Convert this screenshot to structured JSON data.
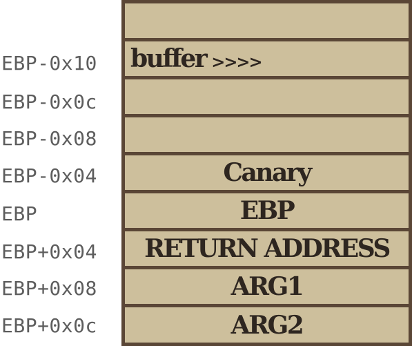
{
  "diagram": {
    "rows": [
      {
        "address": "",
        "content": ""
      },
      {
        "address": "EBP-0x10",
        "content": "buffer",
        "suffix": ">>>>"
      },
      {
        "address": "EBP-0x0c",
        "content": ""
      },
      {
        "address": "EBP-0x08",
        "content": ""
      },
      {
        "address": "EBP-0x04",
        "content": "Canary"
      },
      {
        "address": "EBP",
        "content": "EBP"
      },
      {
        "address": "EBP+0x04",
        "content": "RETURN ADDRESS"
      },
      {
        "address": "EBP+0x08",
        "content": "ARG1"
      },
      {
        "address": "EBP+0x0c",
        "content": "ARG2"
      }
    ]
  },
  "colors": {
    "cell_fill": "#cdbf9c",
    "border": "#5a4636",
    "label_text": "#5d5d5d",
    "cell_text": "#2e2620"
  }
}
